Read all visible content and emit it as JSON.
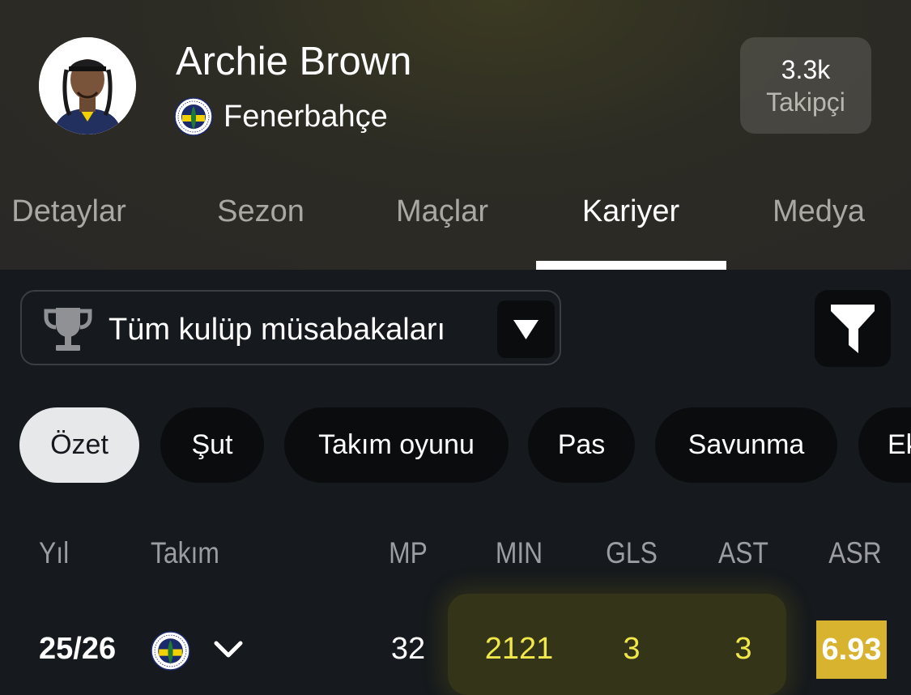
{
  "player": {
    "name": "Archie Brown",
    "club": "Fenerbahçe",
    "followers_count": "3.3k",
    "followers_label": "Takipçi"
  },
  "tabs": [
    {
      "label": "Detaylar",
      "active": false
    },
    {
      "label": "Sezon",
      "active": false
    },
    {
      "label": "Maçlar",
      "active": false
    },
    {
      "label": "Kariyer",
      "active": true
    },
    {
      "label": "Medya",
      "active": false
    }
  ],
  "filters": {
    "competition_label": "Tüm kulüp müsabakaları"
  },
  "categories": [
    {
      "label": "Özet",
      "active": true
    },
    {
      "label": "Şut",
      "active": false
    },
    {
      "label": "Takım oyunu",
      "active": false
    },
    {
      "label": "Pas",
      "active": false
    },
    {
      "label": "Savunma",
      "active": false
    },
    {
      "label": "Ek",
      "active": false
    }
  ],
  "table": {
    "headers": {
      "year": "Yıl",
      "team": "Takım",
      "mp": "MP",
      "min": "MIN",
      "gls": "GLS",
      "ast": "AST",
      "asr": "ASR"
    },
    "rows": [
      {
        "year": "25/26",
        "mp": "32",
        "min": "2121",
        "gls": "3",
        "ast": "3",
        "asr": "6.93"
      }
    ]
  },
  "colors": {
    "accent_yellow": "#f0e84a",
    "rating_bg": "#d8b330",
    "club_navy": "#1b2a6b",
    "club_yellow": "#f2d100"
  }
}
